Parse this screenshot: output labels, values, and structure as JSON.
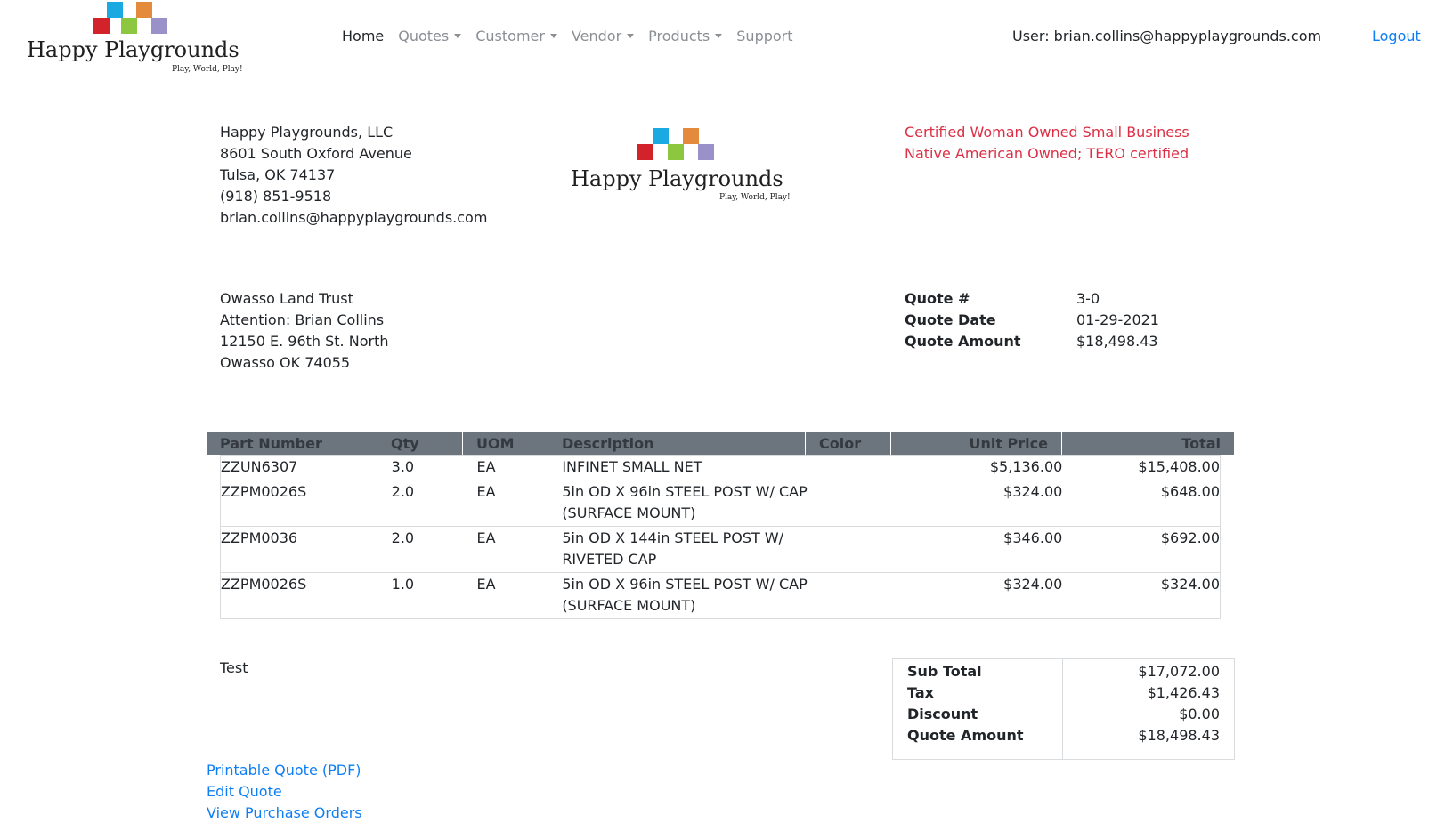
{
  "brand": {
    "name": "Happy Playgrounds",
    "tagline": "Play, World, Play!",
    "colors": {
      "red": "#d2232a",
      "blue": "#1ba9e1",
      "green": "#8dc63f",
      "orange": "#e38a3c",
      "purple": "#9b91c9"
    }
  },
  "nav": {
    "items": [
      {
        "label": "Home",
        "dropdown": false,
        "active": true
      },
      {
        "label": "Quotes",
        "dropdown": true,
        "active": false
      },
      {
        "label": "Customer",
        "dropdown": true,
        "active": false
      },
      {
        "label": "Vendor",
        "dropdown": true,
        "active": false
      },
      {
        "label": "Products",
        "dropdown": true,
        "active": false
      },
      {
        "label": "Support",
        "dropdown": false,
        "active": false
      }
    ],
    "user": "User: brian.collins@happyplaygrounds.com",
    "logout": "Logout"
  },
  "company": {
    "name": "Happy Playgrounds, LLC",
    "street": "8601 South Oxford Avenue",
    "city": "Tulsa, OK 74137",
    "phone": "(918) 851-9518",
    "email": "brian.collins@happyplaygrounds.com"
  },
  "certifications": [
    "Certified Woman Owned Small Business",
    "Native American Owned; TERO certified"
  ],
  "customer": {
    "name": "Owasso Land Trust",
    "attention": "Attention: Brian Collins",
    "street": "12150 E. 96th St. North",
    "city": "Owasso OK 74055"
  },
  "quote": {
    "number_label": "Quote #",
    "number": "3-0",
    "date_label": "Quote Date",
    "date": "01-29-2021",
    "amount_label": "Quote Amount",
    "amount": "$18,498.43"
  },
  "table": {
    "headers": {
      "part": "Part Number",
      "qty": "Qty",
      "uom": "UOM",
      "desc": "Description",
      "color": "Color",
      "unit": "Unit Price",
      "total": "Total"
    },
    "rows": [
      {
        "part": "ZZUN6307",
        "qty": "3.0",
        "uom": "EA",
        "desc": "INFINET SMALL NET",
        "color": "",
        "unit": "$5,136.00",
        "total": "$15,408.00"
      },
      {
        "part": "ZZPM0026S",
        "qty": "2.0",
        "uom": "EA",
        "desc": "5in OD X 96in STEEL POST W/ CAP (SURFACE MOUNT)",
        "color": "",
        "unit": "$324.00",
        "total": "$648.00"
      },
      {
        "part": "ZZPM0036",
        "qty": "2.0",
        "uom": "EA",
        "desc": "5in OD X 144in STEEL POST W/ RIVETED CAP",
        "color": "",
        "unit": "$346.00",
        "total": "$692.00"
      },
      {
        "part": "ZZPM0026S",
        "qty": "1.0",
        "uom": "EA",
        "desc": "5in OD X 96in STEEL POST W/ CAP (SURFACE MOUNT)",
        "color": "",
        "unit": "$324.00",
        "total": "$324.00"
      }
    ]
  },
  "notes": "Test",
  "totals": {
    "subtotal_label": "Sub Total",
    "subtotal": "$17,072.00",
    "tax_label": "Tax",
    "tax": "$1,426.43",
    "discount_label": "Discount",
    "discount": "$0.00",
    "amount_label": "Quote Amount",
    "amount": "$18,498.43"
  },
  "links": {
    "pdf": "Printable Quote (PDF)",
    "edit": "Edit Quote",
    "po": "View Purchase Orders"
  }
}
